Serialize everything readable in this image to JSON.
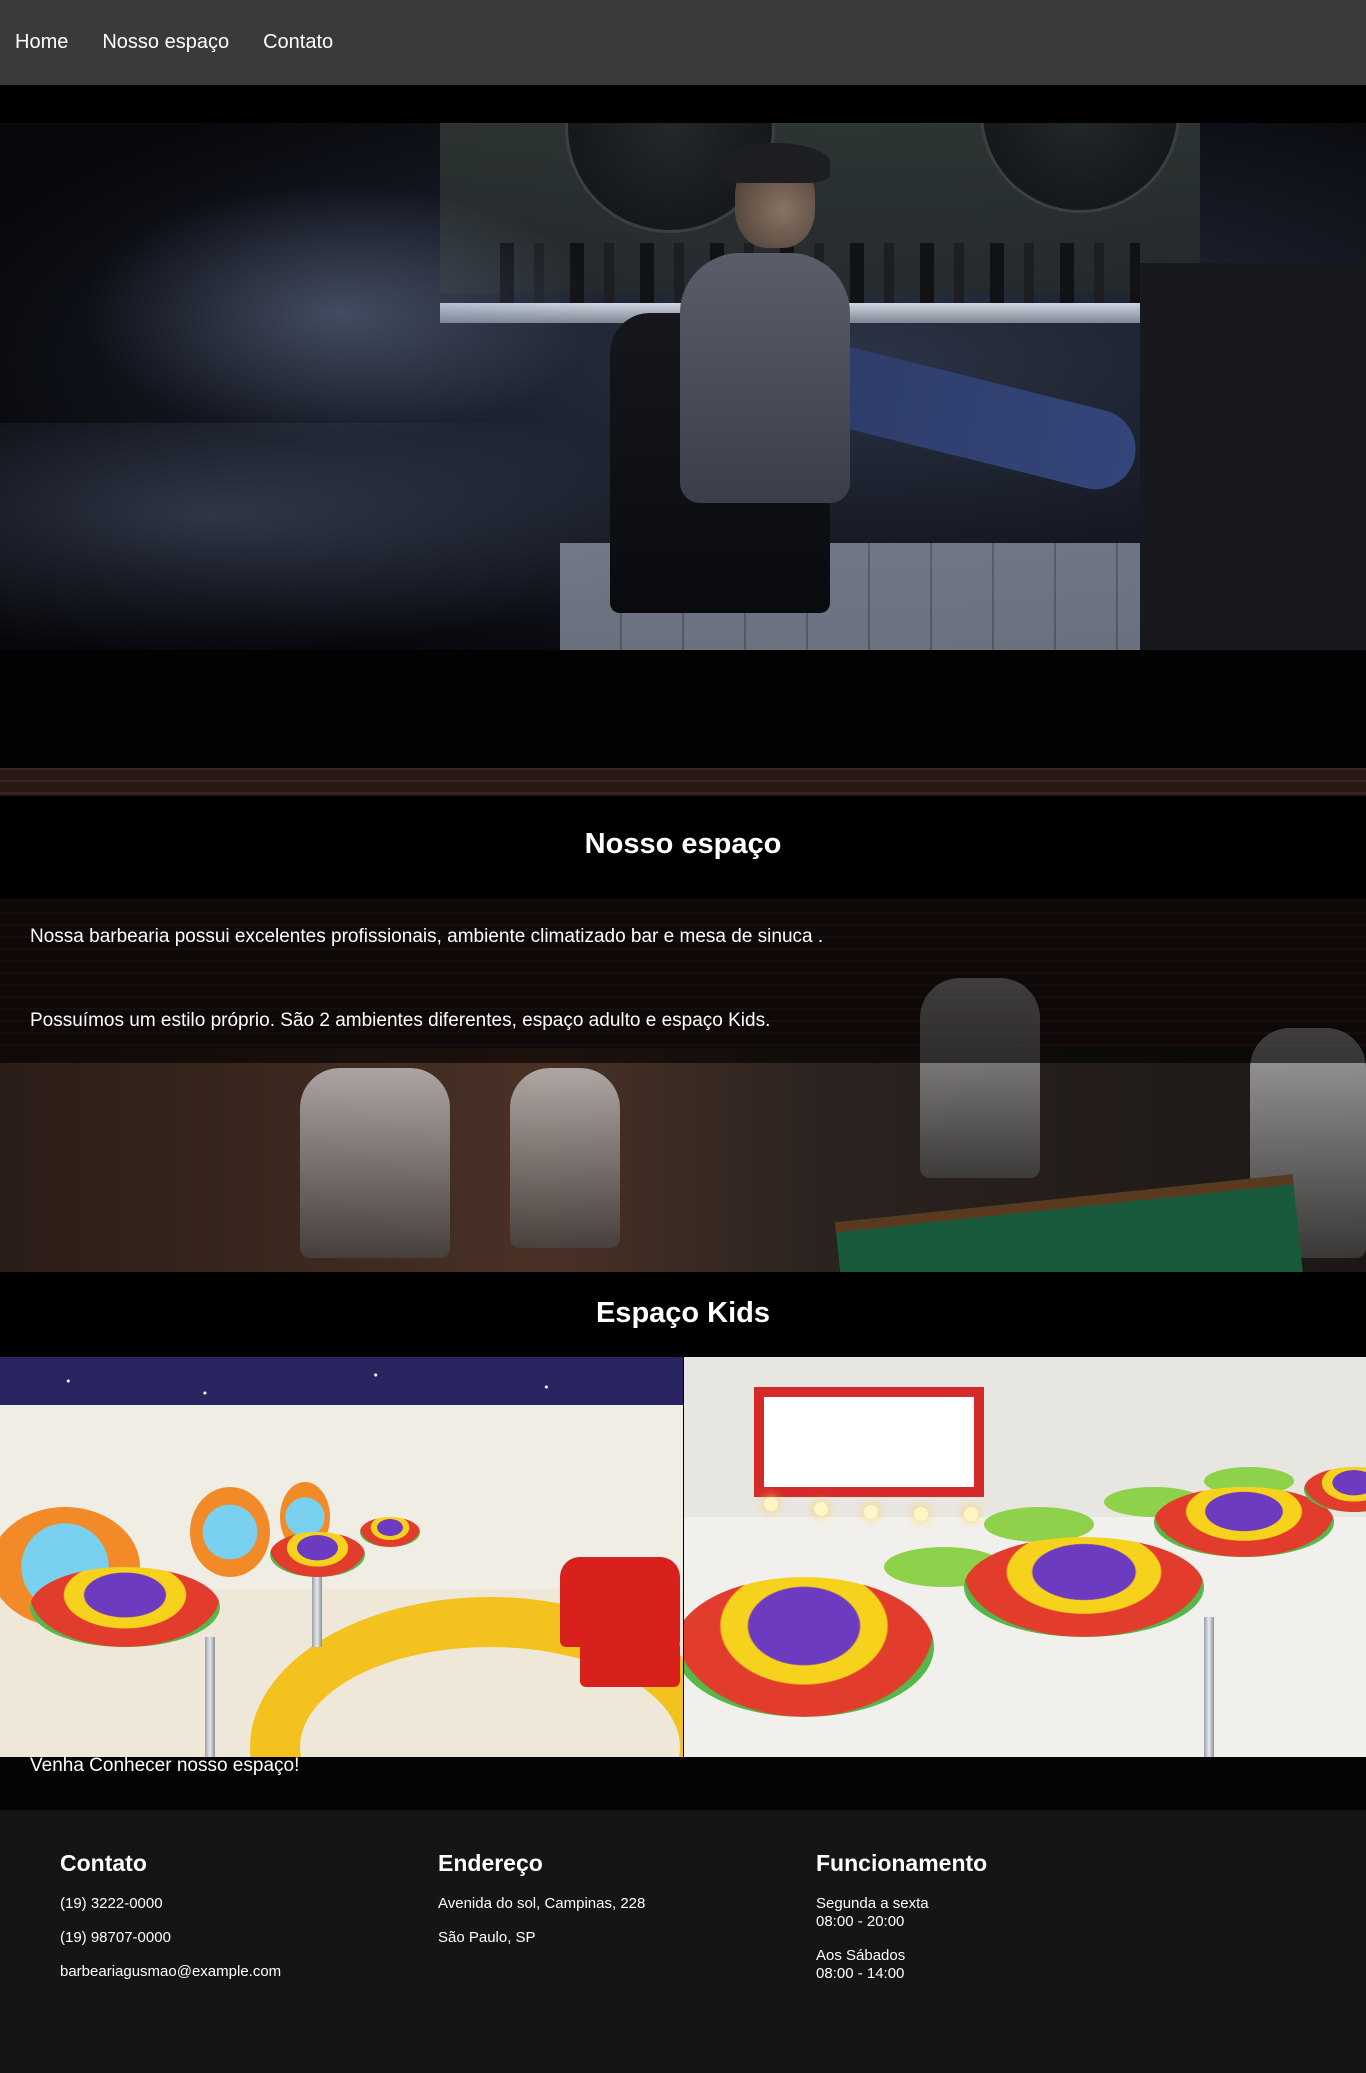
{
  "nav": {
    "items": [
      "Home",
      "Nosso espaço",
      "Contato"
    ]
  },
  "espaco": {
    "title": "Nosso espaço",
    "paragraphs": [
      "Nossa barbearia possui excelentes profissionais, ambiente climatizado bar e mesa de sinuca .",
      "Possuímos um estilo próprio. São 2 ambientes diferentes, espaço adulto e espaço Kids."
    ]
  },
  "kids": {
    "title": "Espaço Kids",
    "caption": "Venha Conhecer nosso espaço!"
  },
  "footer": {
    "contato": {
      "title": "Contato",
      "phone1": "(19) 3222-0000",
      "phone2": "(19) 98707-0000",
      "email": "barbeariagusmao@example.com"
    },
    "endereco": {
      "title": "Endereço",
      "street": "Avenida do sol, Campinas, 228",
      "city": "São Paulo, SP"
    },
    "funcionamento": {
      "title": "Funcionamento",
      "weekdays_label": "Segunda a sexta",
      "weekdays_hours": "08:00 - 20:00",
      "saturday_label": "Aos Sábados",
      "saturday_hours": "08:00 - 14:00"
    }
  }
}
